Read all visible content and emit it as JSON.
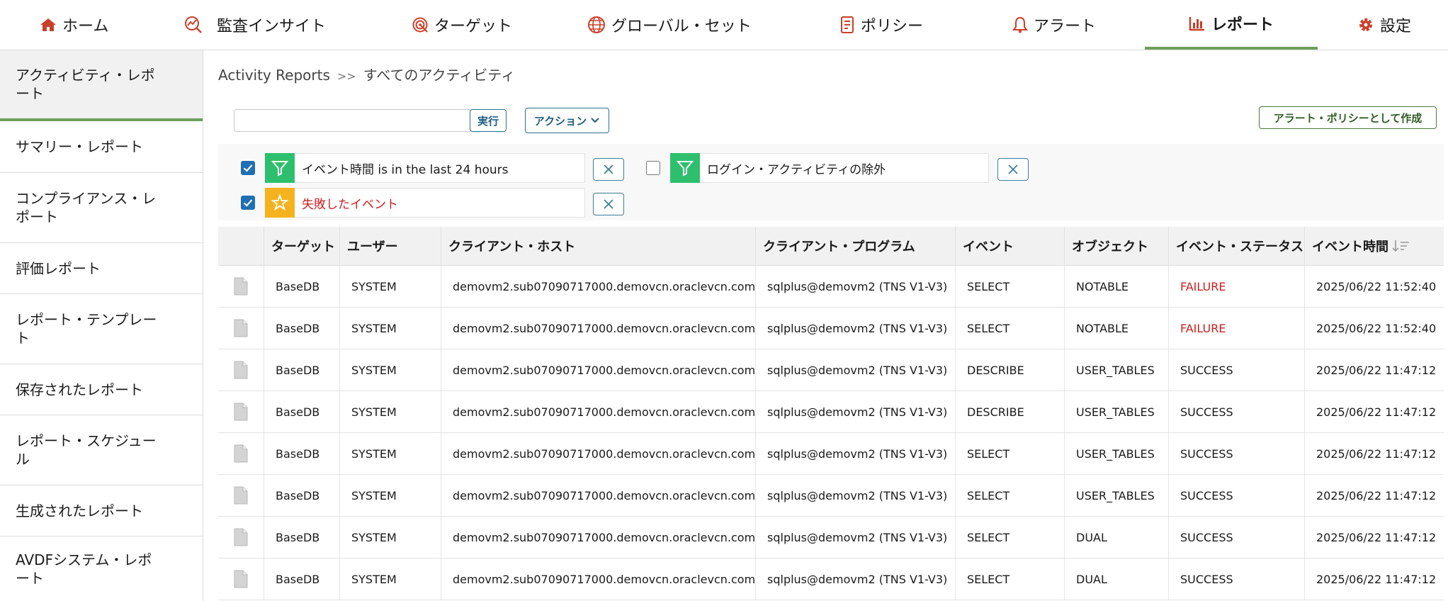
{
  "nav": {
    "items": [
      {
        "label": "ホーム",
        "icon": "home-icon"
      },
      {
        "label": "監査インサイト",
        "icon": "trend-icon"
      },
      {
        "label": "ターゲット",
        "icon": "target-icon"
      },
      {
        "label": "グローバル・セット",
        "icon": "globe-icon"
      },
      {
        "label": "ポリシー",
        "icon": "policy-icon"
      },
      {
        "label": "アラート",
        "icon": "bell-icon"
      },
      {
        "label": "レポート",
        "icon": "bar-chart-icon"
      },
      {
        "label": "設定",
        "icon": "gear-icon"
      }
    ],
    "active": "レポート",
    "icon_color": "#c9402a",
    "accent": "#6b9f5b"
  },
  "sidebar": {
    "items": [
      {
        "label": "アクティビティ・レポート"
      },
      {
        "label": "サマリー・レポート"
      },
      {
        "label": "コンプライアンス・レポート"
      },
      {
        "label": "評価レポート"
      },
      {
        "label": "レポート・テンプレート"
      },
      {
        "label": "保存されたレポート"
      },
      {
        "label": "レポート・スケジュール"
      },
      {
        "label": "生成されたレポート"
      },
      {
        "label": "AVDFシステム・レポート"
      }
    ]
  },
  "breadcrumb": {
    "parent": "Activity Reports",
    "separator": ">>",
    "current": "すべてのアクティビティ"
  },
  "toolbar": {
    "search_value": "",
    "run_label": "実行",
    "actions_label": "アクション",
    "create_alert_label": "アラート・ポリシーとして作成"
  },
  "filters": [
    {
      "checked": true,
      "icon": "filter-icon",
      "icon_color": "#2ebf6e",
      "label_field": "イベント時間",
      "label_rest": " is in the last 24 hours"
    },
    {
      "checked": false,
      "icon": "filter-icon",
      "icon_color": "#2ebf6e",
      "label_field": "ログイン・アクティビティの除外",
      "label_rest": ""
    },
    {
      "checked": true,
      "icon": "star-icon",
      "icon_color": "#f5b21f",
      "label_field": "失敗したイベント",
      "label_rest": ""
    }
  ],
  "table": {
    "columns": [
      "ターゲット",
      "ユーザー",
      "クライアント・ホスト",
      "クライアント・プログラム",
      "イベント",
      "オブジェクト",
      "イベント・ステータス",
      "イベント時間"
    ],
    "rows": [
      [
        "BaseDB",
        "SYSTEM",
        "demovm2.sub07090717000.demovcn.oraclevcn.com",
        "sqlplus@demovm2 (TNS V1-V3)",
        "SELECT",
        "NOTABLE",
        "FAILURE",
        "2025/06/22 11:52:40"
      ],
      [
        "BaseDB",
        "SYSTEM",
        "demovm2.sub07090717000.demovcn.oraclevcn.com",
        "sqlplus@demovm2 (TNS V1-V3)",
        "SELECT",
        "NOTABLE",
        "FAILURE",
        "2025/06/22 11:52:40"
      ],
      [
        "BaseDB",
        "SYSTEM",
        "demovm2.sub07090717000.demovcn.oraclevcn.com",
        "sqlplus@demovm2 (TNS V1-V3)",
        "DESCRIBE",
        "USER_TABLES",
        "SUCCESS",
        "2025/06/22 11:47:12"
      ],
      [
        "BaseDB",
        "SYSTEM",
        "demovm2.sub07090717000.demovcn.oraclevcn.com",
        "sqlplus@demovm2 (TNS V1-V3)",
        "DESCRIBE",
        "USER_TABLES",
        "SUCCESS",
        "2025/06/22 11:47:12"
      ],
      [
        "BaseDB",
        "SYSTEM",
        "demovm2.sub07090717000.demovcn.oraclevcn.com",
        "sqlplus@demovm2 (TNS V1-V3)",
        "SELECT",
        "USER_TABLES",
        "SUCCESS",
        "2025/06/22 11:47:12"
      ],
      [
        "BaseDB",
        "SYSTEM",
        "demovm2.sub07090717000.demovcn.oraclevcn.com",
        "sqlplus@demovm2 (TNS V1-V3)",
        "SELECT",
        "USER_TABLES",
        "SUCCESS",
        "2025/06/22 11:47:12"
      ],
      [
        "BaseDB",
        "SYSTEM",
        "demovm2.sub07090717000.demovcn.oraclevcn.com",
        "sqlplus@demovm2 (TNS V1-V3)",
        "SELECT",
        "DUAL",
        "SUCCESS",
        "2025/06/22 11:47:12"
      ],
      [
        "BaseDB",
        "SYSTEM",
        "demovm2.sub07090717000.demovcn.oraclevcn.com",
        "sqlplus@demovm2 (TNS V1-V3)",
        "SELECT",
        "DUAL",
        "SUCCESS",
        "2025/06/22 11:47:12"
      ]
    ],
    "failure_color": "#cc1f1f"
  }
}
